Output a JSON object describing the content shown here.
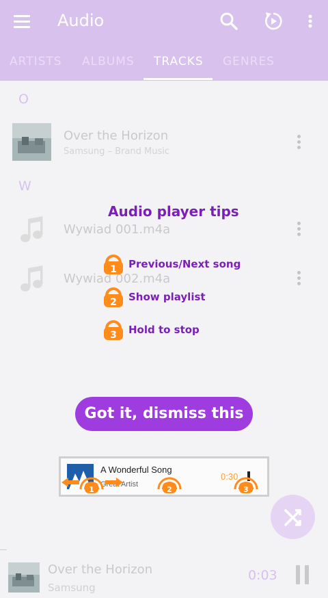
{
  "app": {
    "title": "Audio"
  },
  "tabs": [
    {
      "label": "ARTISTS"
    },
    {
      "label": "ALBUMS"
    },
    {
      "label": "TRACKS",
      "active": true
    },
    {
      "label": "GENRES"
    }
  ],
  "sections": [
    {
      "letter": "O",
      "tracks": [
        {
          "title": "Over the Horizon",
          "subtitle": "Samsung – Brand Music",
          "icon": "album-art"
        }
      ]
    },
    {
      "letter": "W",
      "tracks": [
        {
          "title": "Wywiad 001.m4a",
          "icon": "music-note-icon"
        },
        {
          "title": "Wywiad 002.m4a",
          "icon": "music-note-icon"
        }
      ]
    }
  ],
  "tips": {
    "title": "Audio player tips",
    "items": [
      {
        "number": "1",
        "label": "Previous/Next song"
      },
      {
        "number": "2",
        "label": "Show playlist"
      },
      {
        "number": "3",
        "label": "Hold to stop"
      }
    ],
    "dismiss_label": "Got it, dismiss this",
    "demo": {
      "title": "A Wonderful Song",
      "artist": "Great Artist",
      "time": "0:30",
      "markers": [
        "1",
        "2",
        "3"
      ]
    }
  },
  "player": {
    "title": "Over the Horizon",
    "artist": "Samsung",
    "time": "0:03"
  },
  "colors": {
    "accent": "#d9c1ee",
    "tip_text": "#7b1fb8",
    "tip_badge": "#ff8c1a",
    "dismiss": "#9f3ce0"
  }
}
